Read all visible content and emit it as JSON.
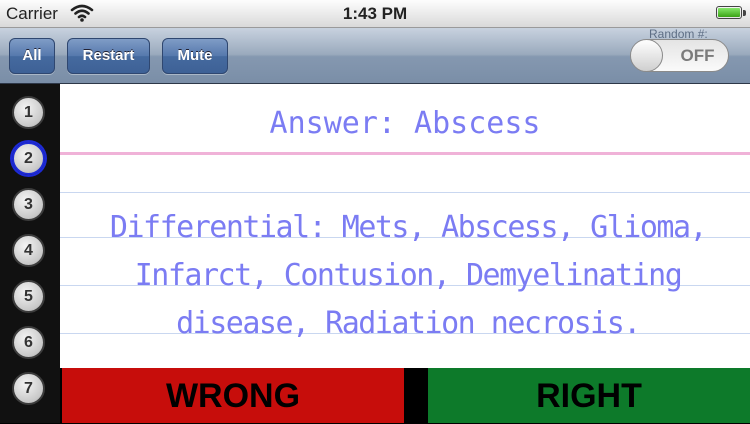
{
  "status_bar": {
    "carrier": "Carrier",
    "time": "1:43 PM",
    "wifi_icon": "wifi-icon",
    "battery_icon": "battery-icon"
  },
  "toolbar": {
    "all_label": "All",
    "restart_label": "Restart",
    "mute_label": "Mute",
    "random_label": "Random #:",
    "random_toggle": {
      "label": "OFF",
      "state": "off"
    }
  },
  "sidebar": {
    "items": [
      {
        "label": "1"
      },
      {
        "label": "2",
        "selected": true
      },
      {
        "label": "3"
      },
      {
        "label": "4"
      },
      {
        "label": "5"
      },
      {
        "label": "6"
      },
      {
        "label": "7"
      }
    ]
  },
  "card": {
    "answer": "Answer: Abscess",
    "differential": "Differential: Mets, Abscess, Glioma, Infarct, Contusion, Demyelinating disease, Radiation necrosis."
  },
  "actions": {
    "wrong_label": "WRONG",
    "right_label": "RIGHT"
  },
  "colors": {
    "card_text": "#7b7cf3",
    "wrong_bg": "#c70d0b",
    "right_bg": "#0d7a2a",
    "toolbar_button": "#4f73a8"
  }
}
